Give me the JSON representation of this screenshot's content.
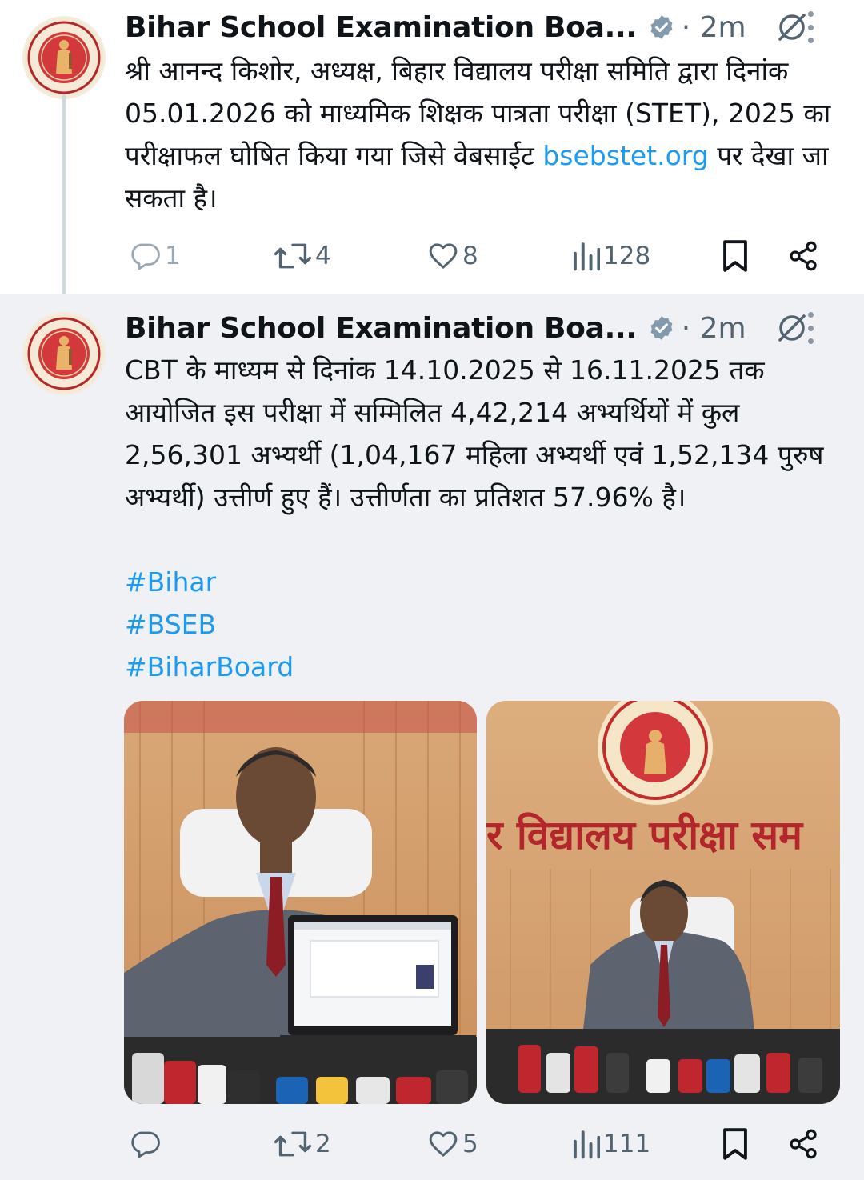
{
  "tweets": [
    {
      "author": "Bihar School Examination Boa...",
      "time": "2m",
      "text_before_link": "श्री आनन्द किशोर, अध्यक्ष, बिहार विद्यालय परीक्षा समिति द्वारा दिनांक 05.01.2026 को माध्यमिक शिक्षक पात्रता परीक्षा (STET), 2025 का परीक्षाफल घोषित किया गया जिसे वेबसाईट ",
      "link": "bsebstet.org",
      "text_after_link": " पर देखा जा सकता है।",
      "replies": "1",
      "reposts": "4",
      "likes": "8",
      "views": "128"
    },
    {
      "author": "Bihar School Examination Boa...",
      "time": "2m",
      "text": "CBT के माध्यम से दिनांक 14.10.2025 से 16.11.2025 तक आयोजित इस परीक्षा में सम्मिलित 4,42,214 अभ्यर्थियों में कुल 2,56,301 अभ्यर्थी (1,04,167 महिला अभ्यर्थी एवं 1,52,134 पुरुष अभ्यर्थी) उत्तीर्ण हुए हैं। उत्तीर्णता का प्रतिशत 57.96% है।",
      "hashtags": [
        "#Bihar",
        "#BSEB",
        "#BiharBoard"
      ],
      "photo2_wall_text": "र विद्यालय परीक्षा सम",
      "replies": "",
      "reposts": "2",
      "likes": "5",
      "views": "111"
    }
  ],
  "colors": {
    "link": "#1d9bf0",
    "verified": "#829aab",
    "muted": "#536471",
    "selected_bg": "#eff1f4"
  },
  "icons": [
    "verified-badge-icon",
    "grok-icon",
    "more-icon",
    "reply-icon",
    "repost-icon",
    "like-icon",
    "views-icon",
    "bookmark-icon",
    "share-icon"
  ]
}
